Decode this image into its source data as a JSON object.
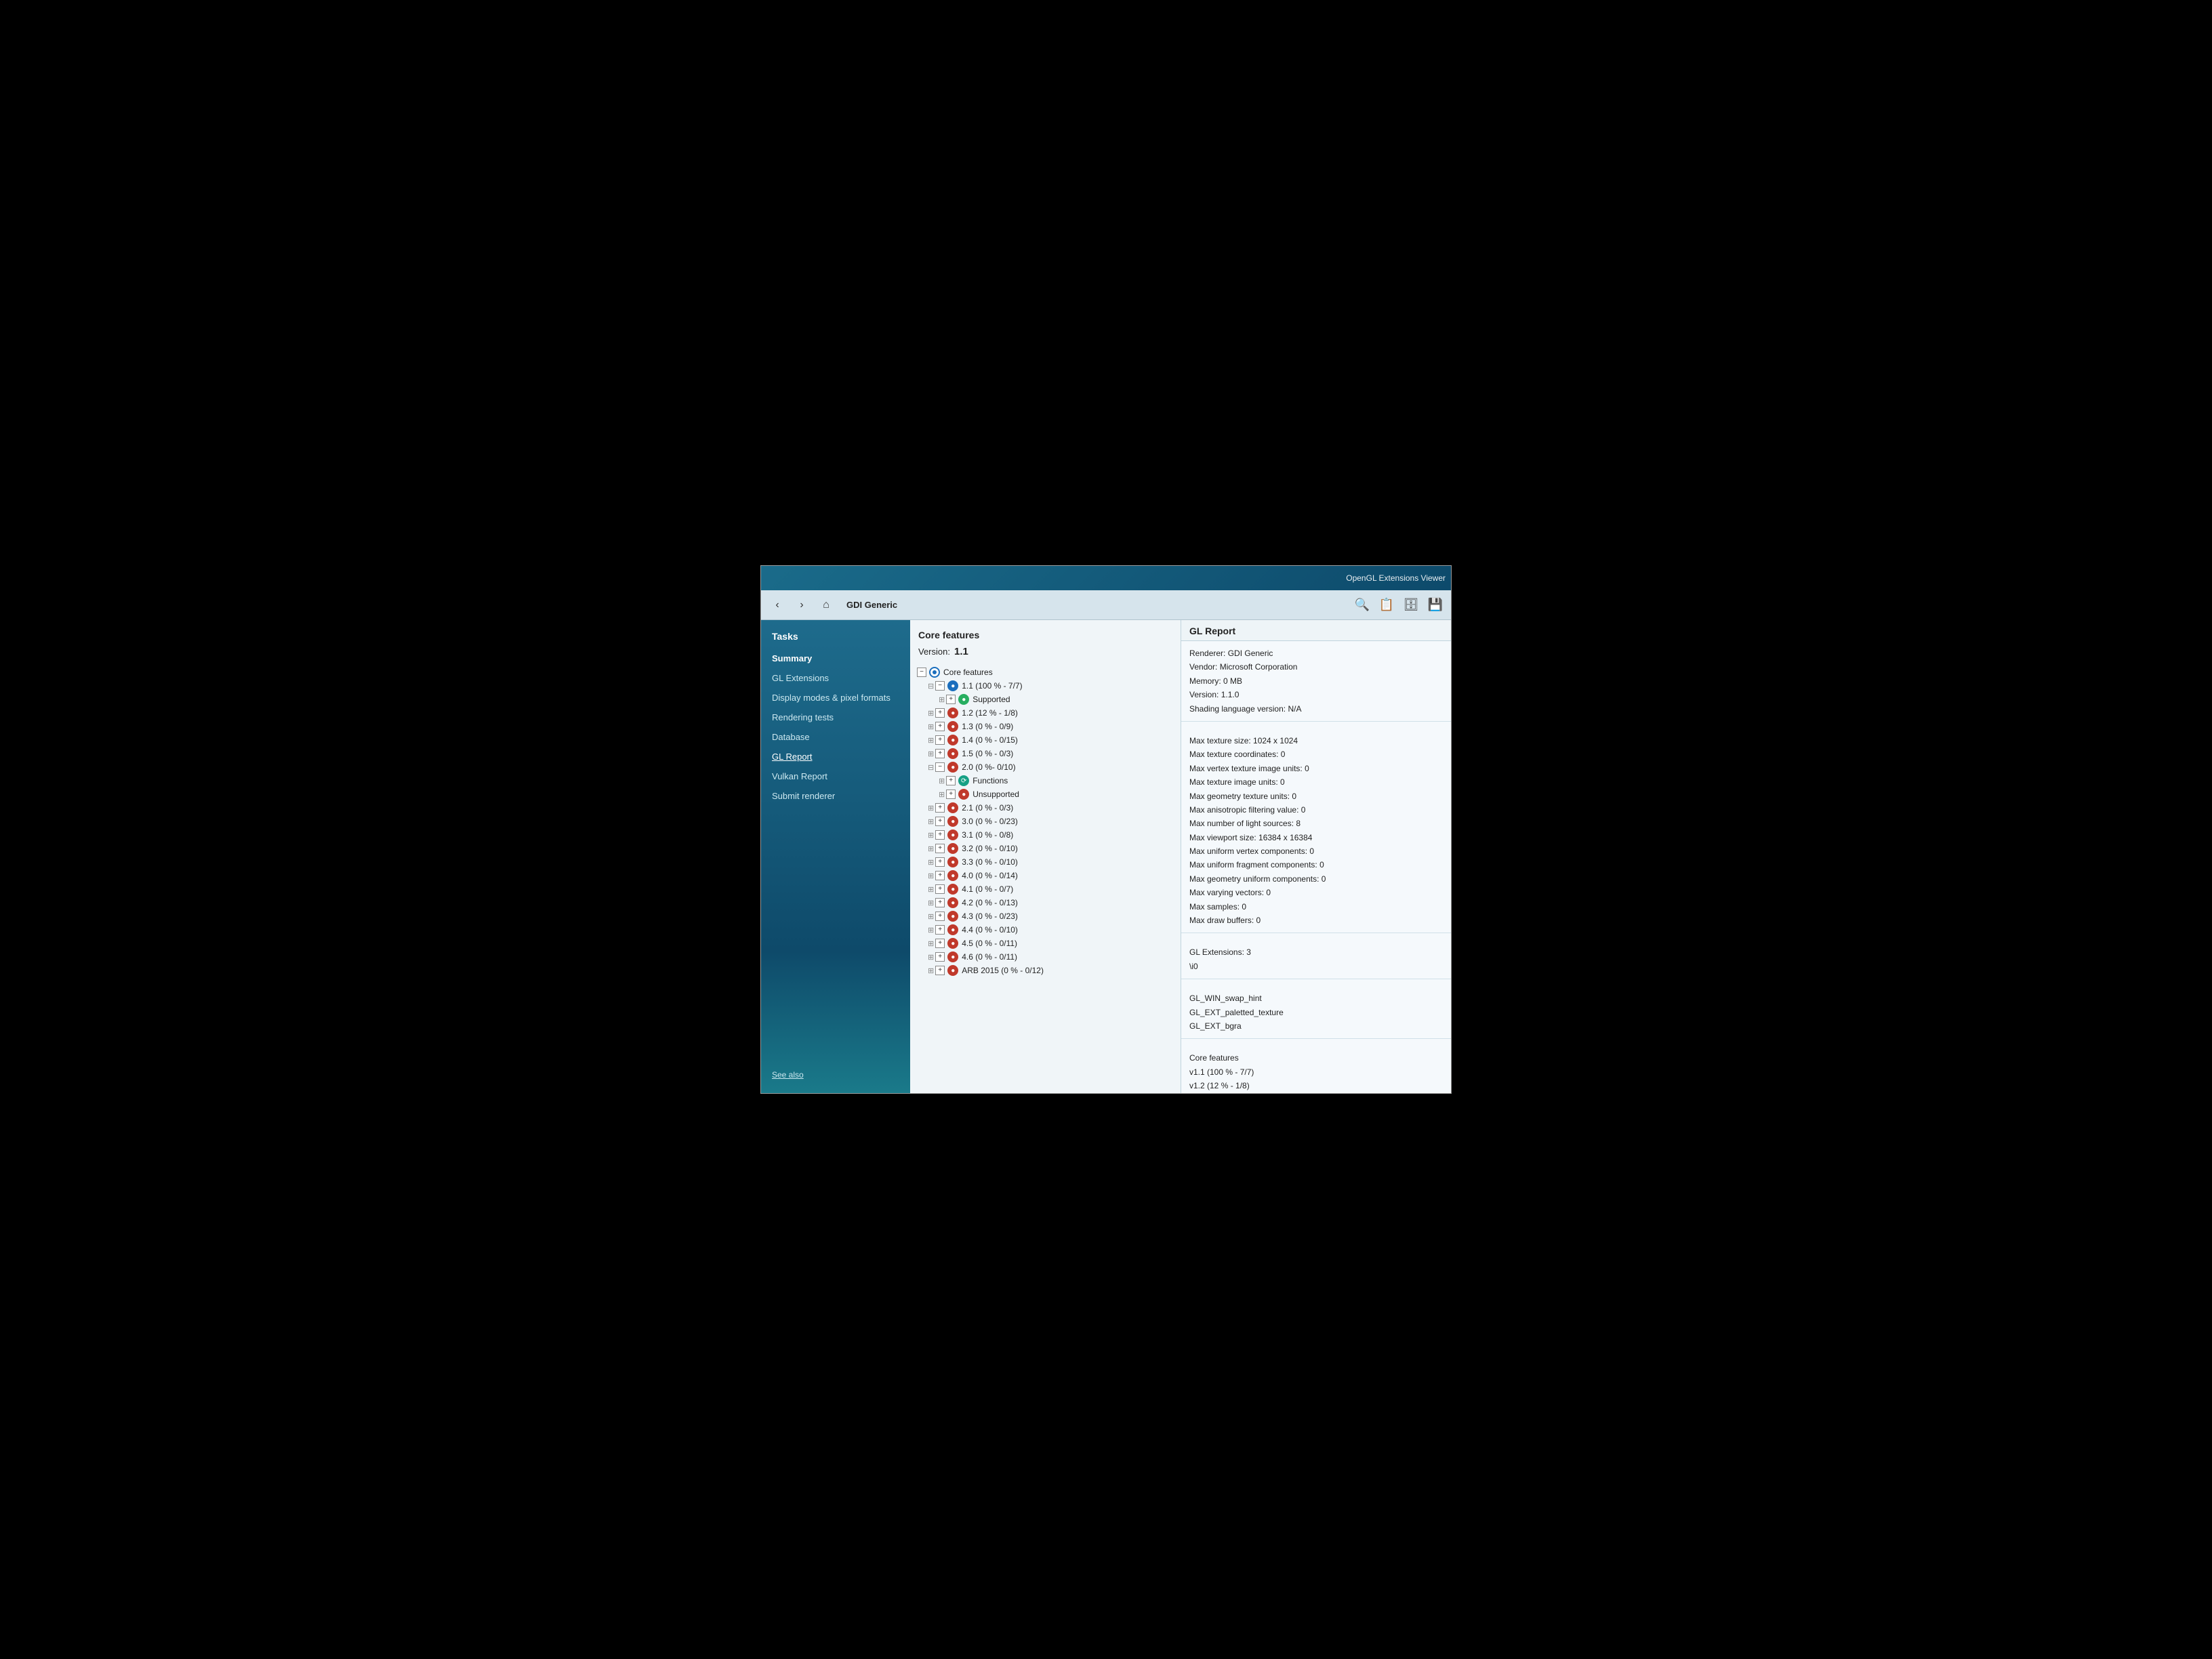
{
  "window": {
    "title": "OpenGL Extensions Viewer"
  },
  "toolbar": {
    "back_label": "‹",
    "forward_label": "›",
    "home_label": "⌂",
    "device_name": "GDI Generic",
    "search_icon": "🔍",
    "copy_icon": "📋",
    "db_icon": "🗄",
    "save_icon": "💾"
  },
  "sidebar": {
    "section_title": "Tasks",
    "items": [
      {
        "id": "summary",
        "label": "Summary",
        "active": false
      },
      {
        "id": "gl-extensions",
        "label": "GL Extensions",
        "active": false
      },
      {
        "id": "display-modes",
        "label": "Display modes & pixel formats",
        "active": false
      },
      {
        "id": "rendering-tests",
        "label": "Rendering tests",
        "active": false
      },
      {
        "id": "database",
        "label": "Database",
        "active": false
      },
      {
        "id": "gl-report",
        "label": "GL Report",
        "active": true
      },
      {
        "id": "vulkan-report",
        "label": "Vulkan Report",
        "active": false
      },
      {
        "id": "submit-renderer",
        "label": "Submit renderer",
        "active": false
      }
    ],
    "footer": "See also"
  },
  "main": {
    "core_features_header": "Core features",
    "version_label": "Version:",
    "version_value": "1.1",
    "tree_items": [
      {
        "indent": 0,
        "expand": "−",
        "icon": "target",
        "label": "Core features"
      },
      {
        "indent": 1,
        "expand": "−",
        "icon": "blue",
        "label": "1.1 (100 % - 7/7)"
      },
      {
        "indent": 2,
        "expand": "+",
        "icon": "green",
        "label": "Supported"
      },
      {
        "indent": 1,
        "expand": "+",
        "icon": "red",
        "label": "1.2 (12 % - 1/8)"
      },
      {
        "indent": 1,
        "expand": "+",
        "icon": "red",
        "label": "1.3 (0 % - 0/9)"
      },
      {
        "indent": 1,
        "expand": "+",
        "icon": "red",
        "label": "1.4 (0 % - 0/15)"
      },
      {
        "indent": 1,
        "expand": "+",
        "icon": "red",
        "label": "1.5 (0 % - 0/3)"
      },
      {
        "indent": 1,
        "expand": "−",
        "icon": "red",
        "label": "2.0 (0 %- 0/10)"
      },
      {
        "indent": 2,
        "expand": "+",
        "icon": "teal",
        "label": "Functions"
      },
      {
        "indent": 2,
        "expand": "+",
        "icon": "red",
        "label": "Unsupported"
      },
      {
        "indent": 1,
        "expand": "+",
        "icon": "red",
        "label": "2.1 (0 % - 0/3)"
      },
      {
        "indent": 1,
        "expand": "+",
        "icon": "red",
        "label": "3.0 (0 % - 0/23)"
      },
      {
        "indent": 1,
        "expand": "+",
        "icon": "red",
        "label": "3.1 (0 % - 0/8)"
      },
      {
        "indent": 1,
        "expand": "+",
        "icon": "red",
        "label": "3.2 (0 % - 0/10)"
      },
      {
        "indent": 1,
        "expand": "+",
        "icon": "red",
        "label": "3.3 (0 % - 0/10)"
      },
      {
        "indent": 1,
        "expand": "+",
        "icon": "red",
        "label": "4.0 (0 % - 0/14)"
      },
      {
        "indent": 1,
        "expand": "+",
        "icon": "red",
        "label": "4.1 (0 % - 0/7)"
      },
      {
        "indent": 1,
        "expand": "+",
        "icon": "red",
        "label": "4.2 (0 % - 0/13)"
      },
      {
        "indent": 1,
        "expand": "+",
        "icon": "red",
        "label": "4.3 (0 % - 0/23)"
      },
      {
        "indent": 1,
        "expand": "+",
        "icon": "red",
        "label": "4.4 (0 % - 0/10)"
      },
      {
        "indent": 1,
        "expand": "+",
        "icon": "red",
        "label": "4.5 (0 % - 0/11)"
      },
      {
        "indent": 1,
        "expand": "+",
        "icon": "red",
        "label": "4.6 (0 % - 0/11)"
      },
      {
        "indent": 1,
        "expand": "+",
        "icon": "red",
        "label": "ARB 2015 (0 % - 0/12)"
      }
    ],
    "info_header": "GL Report",
    "info_sections": [
      {
        "lines": [
          "Renderer: GDI Generic",
          "Vendor: Microsoft Corporation",
          "Memory: 0 MB",
          "Version: 1.1.0",
          "Shading language version: N/A"
        ]
      },
      {
        "lines": [
          "Max texture size: 1024 x 1024",
          "Max texture coordinates: 0",
          "Max vertex texture image units: 0",
          "Max texture image units: 0",
          "Max geometry texture units: 0",
          "Max anisotropic filtering value: 0",
          "Max number of light sources: 8",
          "Max viewport size: 16384 x 16384",
          "Max uniform vertex components: 0",
          "Max uniform fragment components: 0",
          "Max geometry uniform components: 0",
          "Max varying vectors: 0",
          "Max samples: 0",
          "Max draw buffers: 0"
        ]
      },
      {
        "lines": [
          "GL Extensions: 3",
          "\\i0"
        ]
      },
      {
        "lines": [
          "GL_WIN_swap_hint",
          "GL_EXT_paletted_texture",
          "GL_EXT_bgra"
        ]
      },
      {
        "lines": [
          "Core features",
          "v1.1 (100 % - 7/7)",
          "v1.2 (12 % - 1/8)"
        ]
      }
    ]
  }
}
